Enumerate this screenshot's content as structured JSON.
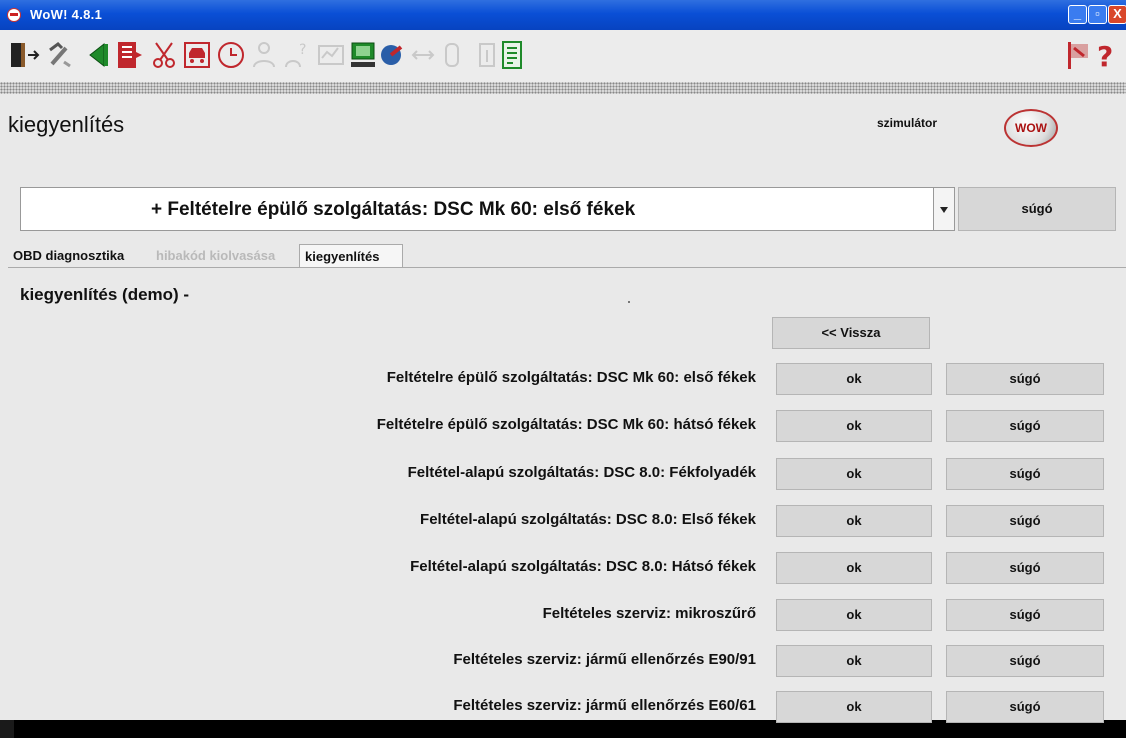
{
  "window": {
    "title": "WoW! 4.8.1"
  },
  "toolbar": {
    "icons": [
      "exit-door-icon",
      "tools-icon",
      "back-arrow-icon",
      "book-icon",
      "scissors-icon",
      "car-icon",
      "clock-icon",
      "person-icon",
      "question-person-icon",
      "chart-icon",
      "computer-icon",
      "circle-arrow-icon",
      "arrows-icon",
      "settings-icon",
      "info-icon",
      "document-icon",
      "flag-icon",
      "help-icon"
    ]
  },
  "header": {
    "title": "kiegyenlítés",
    "mode": "szimulátor",
    "logo_text": "WOW"
  },
  "selector": {
    "value": "+ Feltételre épülő szolgáltatás: DSC Mk 60: első fékek",
    "help_label": "súgó"
  },
  "tabs": [
    {
      "label": "OBD diagnosztika",
      "state": "normal"
    },
    {
      "label": "hibakód kiolvasása",
      "state": "disabled"
    },
    {
      "label": "kiegyenlítés",
      "state": "active"
    }
  ],
  "main": {
    "subtitle": "kiegyenlítés (demo) -",
    "back_label": "<< Vissza",
    "rows": [
      {
        "label": "Feltételre épülő szolgáltatás: DSC Mk 60: első fékek",
        "ok": "ok",
        "help": "súgó"
      },
      {
        "label": "Feltételre épülő szolgáltatás: DSC Mk 60: hátsó fékek",
        "ok": "ok",
        "help": "súgó"
      },
      {
        "label": "Feltétel-alapú szolgáltatás: DSC 8.0: Fékfolyadék",
        "ok": "ok",
        "help": "súgó"
      },
      {
        "label": "Feltétel-alapú szolgáltatás: DSC 8.0: Első fékek",
        "ok": "ok",
        "help": "súgó"
      },
      {
        "label": "Feltétel-alapú szolgáltatás: DSC 8.0: Hátsó fékek",
        "ok": "ok",
        "help": "súgó"
      },
      {
        "label": "Feltételes szerviz: mikroszűrő",
        "ok": "ok",
        "help": "súgó"
      },
      {
        "label": "Feltételes szerviz: jármű ellenőrzés E90/91",
        "ok": "ok",
        "help": "súgó"
      },
      {
        "label": "Feltételes szerviz: jármű ellenőrzés E60/61",
        "ok": "ok",
        "help": "súgó"
      }
    ]
  }
}
